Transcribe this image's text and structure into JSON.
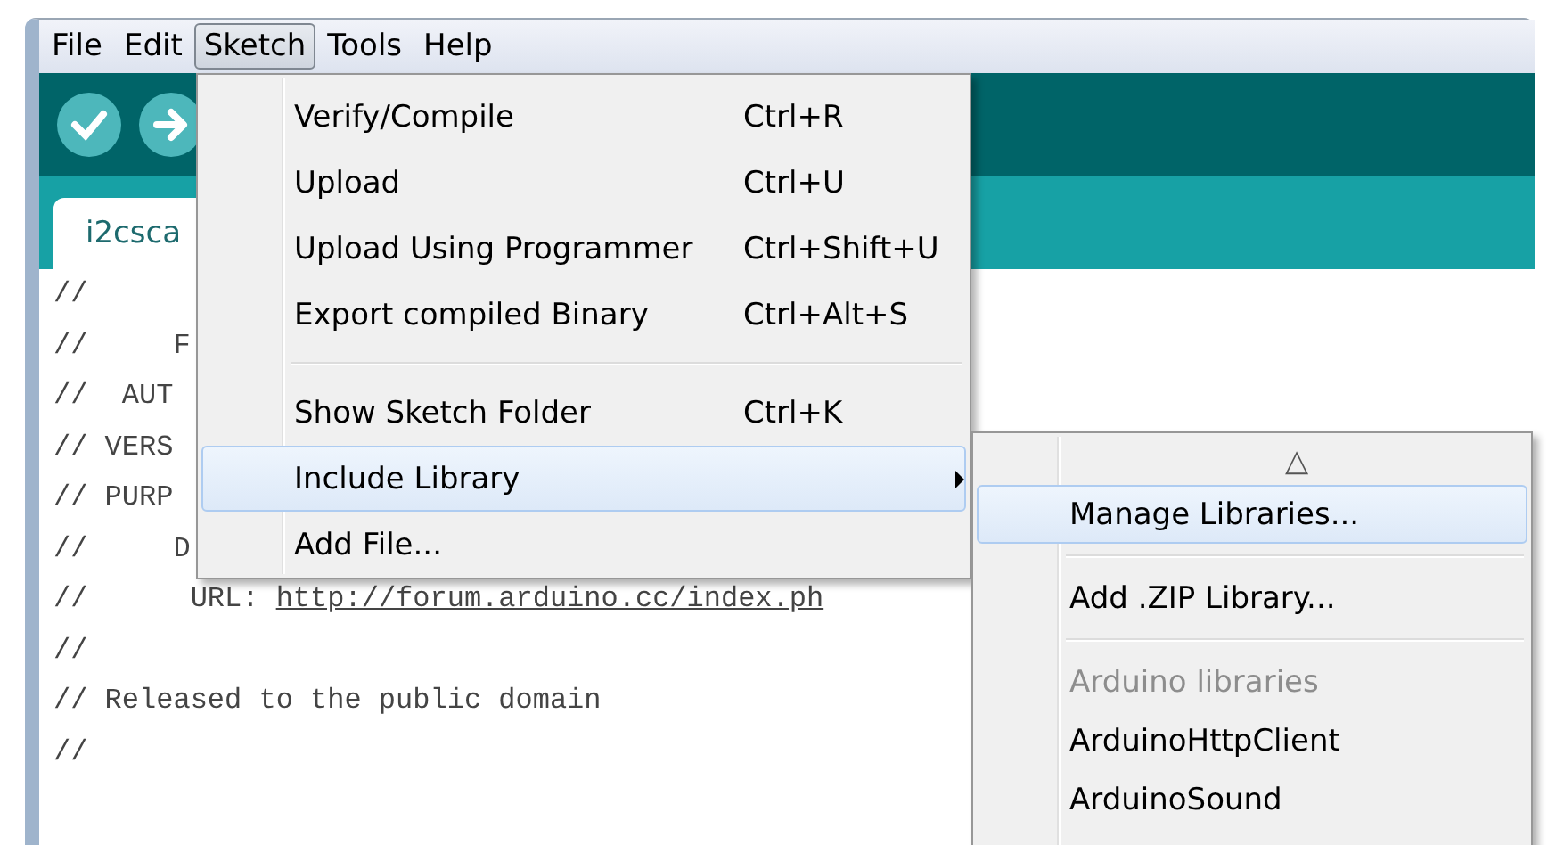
{
  "menubar": [
    {
      "label": "File",
      "selected": false
    },
    {
      "label": "Edit",
      "selected": false
    },
    {
      "label": "Sketch",
      "selected": true
    },
    {
      "label": "Tools",
      "selected": false
    },
    {
      "label": "Help",
      "selected": false
    }
  ],
  "toolbar": [
    {
      "kind": "verify"
    },
    {
      "kind": "upload"
    }
  ],
  "tabs": [
    {
      "label": "i2csca",
      "selected": true
    }
  ],
  "code_lines": [
    {
      "text": "//"
    },
    {
      "text": "//     F"
    },
    {
      "text": "//  AUT"
    },
    {
      "text": "// VERS"
    },
    {
      "text": "// PURP"
    },
    {
      "text": "//     D"
    },
    {
      "text": "//      URL: ",
      "link": "http://forum.arduino.cc/index.ph"
    },
    {
      "text": "//"
    },
    {
      "text": "// Released to the public domain"
    },
    {
      "text": "//"
    }
  ],
  "sketch_menu": [
    {
      "kind": "item",
      "label": "Verify/Compile",
      "shortcut": "Ctrl+R",
      "selected": false,
      "submenu": false
    },
    {
      "kind": "item",
      "label": "Upload",
      "shortcut": "Ctrl+U",
      "selected": false,
      "submenu": false
    },
    {
      "kind": "item",
      "label": "Upload Using Programmer",
      "shortcut": "Ctrl+Shift+U",
      "selected": false,
      "submenu": false
    },
    {
      "kind": "item",
      "label": "Export compiled Binary",
      "shortcut": "Ctrl+Alt+S",
      "selected": false,
      "submenu": false
    },
    {
      "kind": "separator"
    },
    {
      "kind": "item",
      "label": "Show Sketch Folder",
      "shortcut": "Ctrl+K",
      "selected": false,
      "submenu": false
    },
    {
      "kind": "item",
      "label": "Include Library",
      "selected": true,
      "submenu": true
    },
    {
      "kind": "item",
      "label": "Add File...",
      "selected": false,
      "submenu": false
    }
  ],
  "include_library_menu": [
    {
      "kind": "scroll",
      "label": "△"
    },
    {
      "kind": "item",
      "label": "Manage Libraries...",
      "selected": true,
      "disabled": false
    },
    {
      "kind": "separator"
    },
    {
      "kind": "item",
      "label": "Add .ZIP Library...",
      "selected": false,
      "disabled": false
    },
    {
      "kind": "separator"
    },
    {
      "kind": "item",
      "label": "Arduino libraries",
      "selected": false,
      "disabled": true
    },
    {
      "kind": "item",
      "label": "ArduinoHttpClient",
      "selected": false,
      "disabled": false
    },
    {
      "kind": "item",
      "label": "ArduinoSound",
      "selected": false,
      "disabled": false
    }
  ]
}
